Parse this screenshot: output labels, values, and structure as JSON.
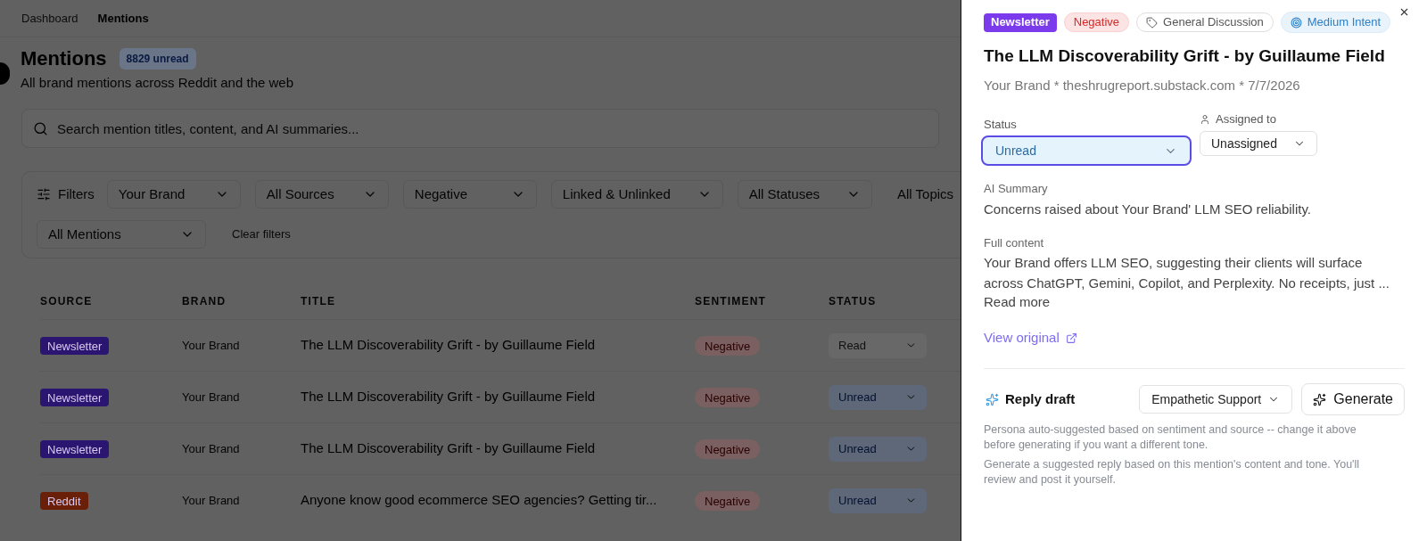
{
  "breadcrumb": [
    {
      "label": "Dashboard",
      "current": false
    },
    {
      "label": "Mentions",
      "current": true
    }
  ],
  "header": {
    "title": "Mentions",
    "badge": "8829 unread",
    "subtitle": "All brand mentions across Reddit and the web"
  },
  "search": {
    "placeholder": "Search mention titles, content, and AI summaries..."
  },
  "filters": {
    "label": "Filters",
    "dropdowns": [
      {
        "label": "Your Brand",
        "kind": "select"
      },
      {
        "label": "All Sources",
        "kind": "select"
      },
      {
        "label": "Negative",
        "kind": "select"
      },
      {
        "label": "Linked & Unlinked",
        "kind": "select"
      },
      {
        "label": "All Statuses",
        "kind": "select"
      },
      {
        "label": "All Topics",
        "kind": "clipped"
      }
    ],
    "view": "All Mentions",
    "clear": "Clear filters"
  },
  "table": {
    "columns": [
      "SOURCE",
      "BRAND",
      "TITLE",
      "SENTIMENT",
      "STATUS"
    ],
    "rows": [
      {
        "source": {
          "label": "Newsletter",
          "color": "#2a1670"
        },
        "brand": "Your Brand",
        "title": "The LLM Discoverability Grift - by Guillaume Field",
        "sentiment": "Negative",
        "status": "Read",
        "unread": false
      },
      {
        "source": {
          "label": "Newsletter",
          "color": "#2a1670"
        },
        "brand": "Your Brand",
        "title": "The LLM Discoverability Grift - by Guillaume Field",
        "sentiment": "Negative",
        "status": "Unread",
        "unread": true
      },
      {
        "source": {
          "label": "Newsletter",
          "color": "#2a1670"
        },
        "brand": "Your Brand",
        "title": "The LLM Discoverability Grift - by Guillaume Field",
        "sentiment": "Negative",
        "status": "Unread",
        "unread": true
      },
      {
        "source": {
          "label": "Reddit",
          "color": "#6a2008"
        },
        "brand": "Your Brand",
        "title": "Anyone know good ecommerce SEO agencies? Getting tir...",
        "sentiment": "Negative",
        "status": "Unread",
        "unread": true
      }
    ]
  },
  "detail": {
    "tags": [
      {
        "label": "Newsletter",
        "kind": "source"
      },
      {
        "label": "Negative",
        "kind": "sentiment"
      },
      {
        "label": "General Discussion",
        "kind": "topic"
      },
      {
        "label": "Medium Intent",
        "kind": "intent"
      }
    ],
    "title": "The LLM Discoverability Grift - by Guillaume Field",
    "meta": "Your Brand * theshrugreport.substack.com * 7/7/2026",
    "status": {
      "label": "Status",
      "value": "Unread",
      "focused": true
    },
    "assignee": {
      "label": "Assigned to",
      "value": "Unassigned"
    },
    "summary": {
      "label": "AI Summary",
      "text": "Concerns raised about Your Brand' LLM SEO reliability."
    },
    "content": {
      "label": "Full content",
      "text": "Your Brand offers LLM SEO, suggesting their clients will surface across ChatGPT, Gemini, Copilot, and Perplexity. No receipts, just ...",
      "read_more": "Read more"
    },
    "view_original": "View original",
    "reply": {
      "title": "Reply draft",
      "persona": "Empathetic Support",
      "generate": "Generate",
      "notes": [
        "Persona auto-suggested based on sentiment and source -- change it above before generating if you want a different tone.",
        "Generate a suggested reply based on this mention's content and tone. You'll review and post it yourself."
      ]
    }
  }
}
